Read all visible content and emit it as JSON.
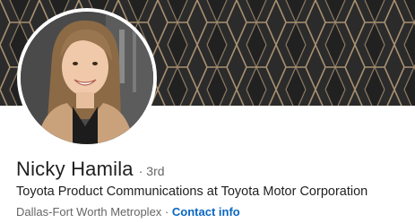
{
  "profile": {
    "name": "Nicky Hamila",
    "degree": "· 3rd",
    "headline": "Toyota Product Communications at Toyota Motor Corporation",
    "location": "Dallas-Fort Worth Metroplex",
    "separator": "·",
    "contact_label": "Contact info"
  },
  "banner": {
    "background_color": "#2b2b2b",
    "pattern_color": "#a89070"
  },
  "colors": {
    "link": "#0a66c2",
    "secondary_text": "#666666",
    "primary_text": "#1f1f1f"
  }
}
